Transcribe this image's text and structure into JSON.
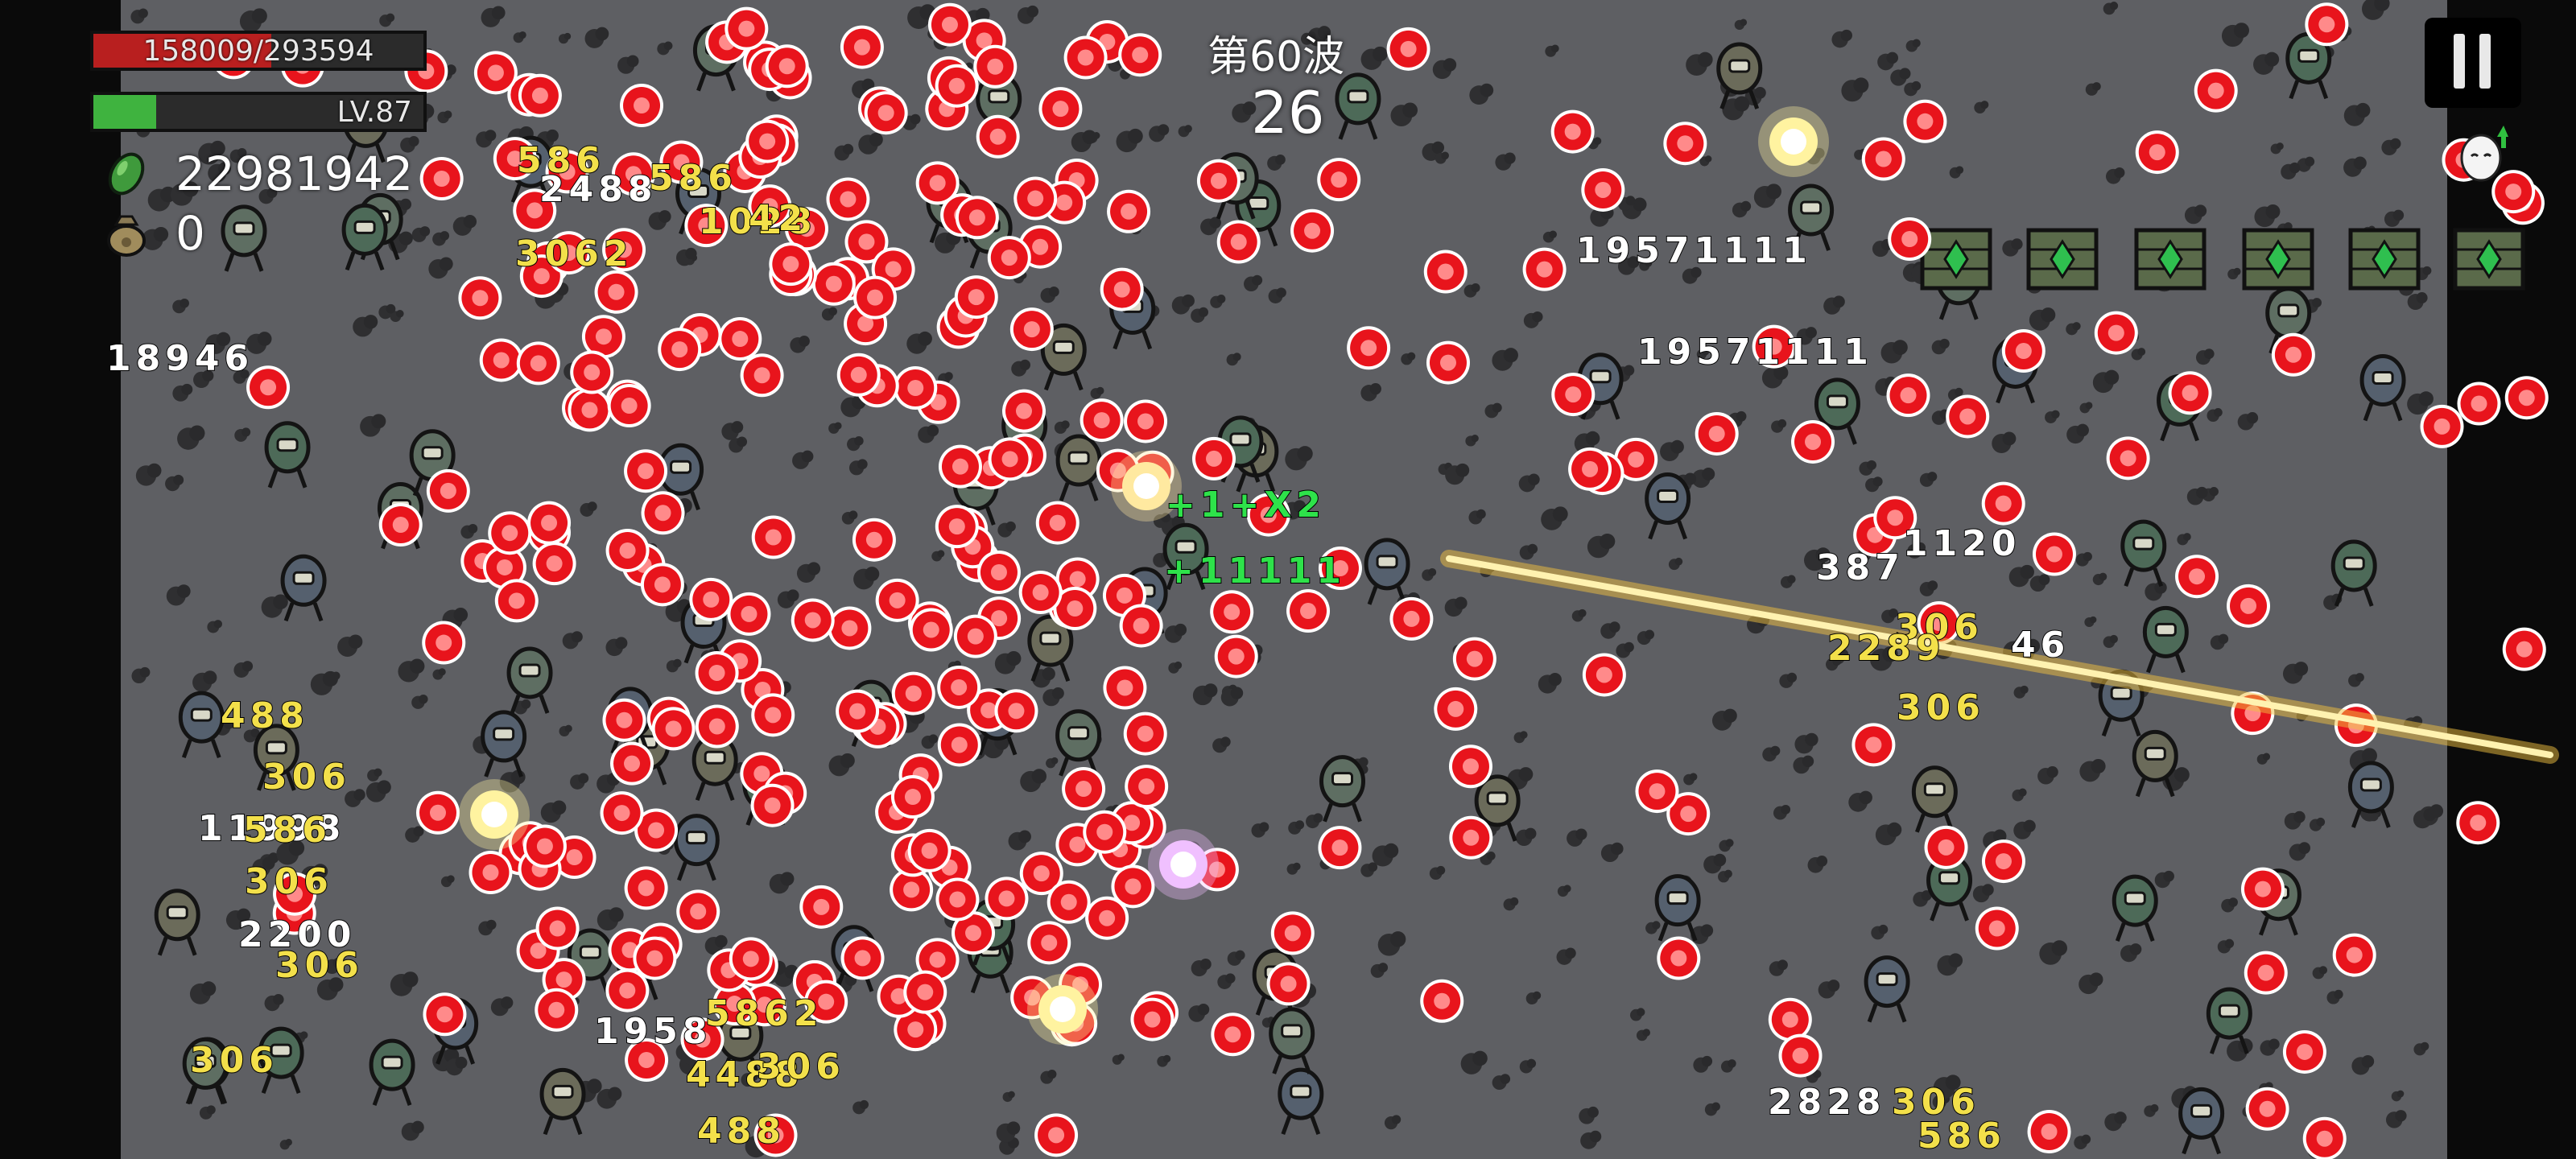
{
  "hud": {
    "hp_text": "158009/293594",
    "hp_fraction": 0.538,
    "hp_color": "#b81f1f",
    "xp_text": "LV.87",
    "xp_fraction": 0.19,
    "xp_color": "#3fb33f",
    "currency_icon": "green-gem-icon",
    "currency_value": "22981942",
    "bag_icon": "loot-bag-icon",
    "bag_value": "0"
  },
  "wave": {
    "title": "第60波",
    "timer": "26"
  },
  "controls": {
    "pause_icon": "pause-icon",
    "avatar_icon": "egg-character-icon"
  },
  "colors": {
    "arena": "#5e5f63",
    "border": "#0a0a0a",
    "bullet_red": "#e8141c",
    "damage_yellow": "#f3e04a",
    "heal_green": "#2ee24a",
    "laser": "#f0c040"
  },
  "damage_numbers": [
    {
      "text": "586",
      "color": "y"
    },
    {
      "text": "2488",
      "color": "w"
    },
    {
      "text": "586",
      "color": "y"
    },
    {
      "text": "1028",
      "color": "y"
    },
    {
      "text": "3062",
      "color": "y"
    },
    {
      "text": "42",
      "color": "y"
    },
    {
      "text": "18946",
      "color": "w"
    },
    {
      "text": "488",
      "color": "y"
    },
    {
      "text": "306",
      "color": "y"
    },
    {
      "text": "11998",
      "color": "w"
    },
    {
      "text": "586",
      "color": "y"
    },
    {
      "text": "306",
      "color": "y"
    },
    {
      "text": "2200",
      "color": "w"
    },
    {
      "text": "306",
      "color": "y"
    },
    {
      "text": "306",
      "color": "y"
    },
    {
      "text": "1958",
      "color": "w"
    },
    {
      "text": "5862",
      "color": "y"
    },
    {
      "text": "4488",
      "color": "y"
    },
    {
      "text": "306",
      "color": "y"
    },
    {
      "text": "488",
      "color": "y"
    },
    {
      "text": "19571111",
      "color": "w"
    },
    {
      "text": "19571111",
      "color": "w"
    },
    {
      "text": "1120",
      "color": "w"
    },
    {
      "text": "387",
      "color": "w"
    },
    {
      "text": "306",
      "color": "y"
    },
    {
      "text": "2289",
      "color": "y"
    },
    {
      "text": "46",
      "color": "w"
    },
    {
      "text": "306",
      "color": "y"
    },
    {
      "text": "2828",
      "color": "w"
    },
    {
      "text": "306",
      "color": "y"
    },
    {
      "text": "586",
      "color": "y"
    },
    {
      "text": "+1+X2",
      "color": "g"
    },
    {
      "text": "+11111",
      "color": "g"
    }
  ]
}
